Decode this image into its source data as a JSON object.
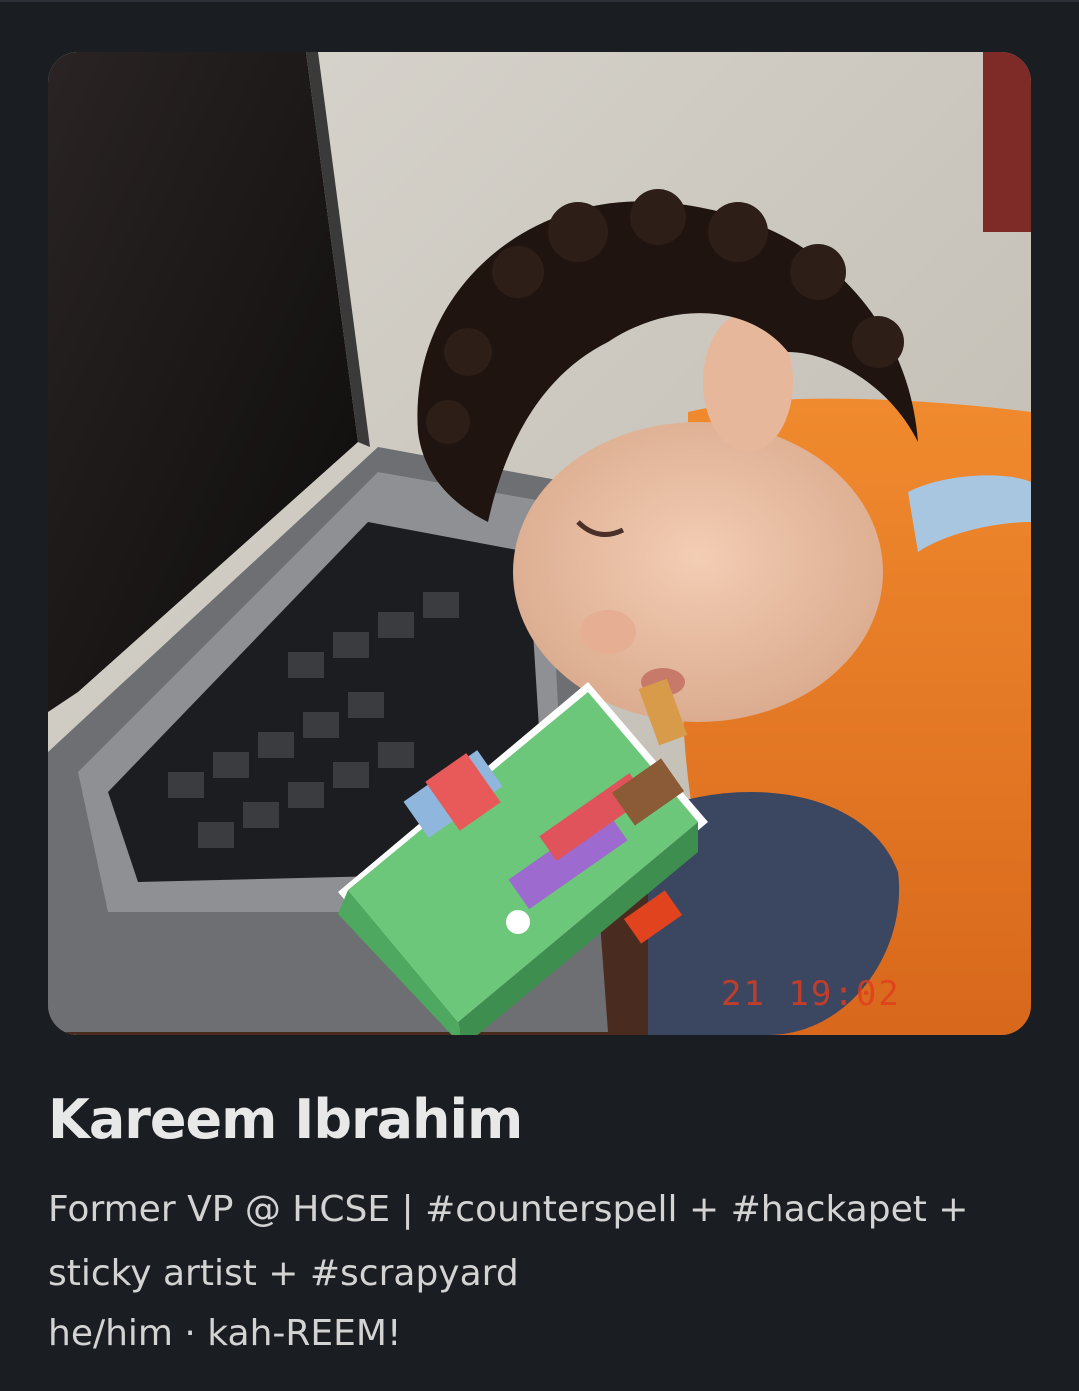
{
  "profile": {
    "name": "Kareem Ibrahim",
    "bio": "Former VP @ HCSE | #counterspell + #hackapet + sticky artist + #scrapyard",
    "pronouns": "he/him · kah-REEM!",
    "photo_timestamp": "21 19:02"
  },
  "colors": {
    "background": "#1a1d21",
    "name_text": "#e8e8e8",
    "bio_text": "#d3d3d3",
    "timestamp": "#e03c1e"
  },
  "icons": {
    "sticker": "pixel-garden-box-sticker"
  }
}
